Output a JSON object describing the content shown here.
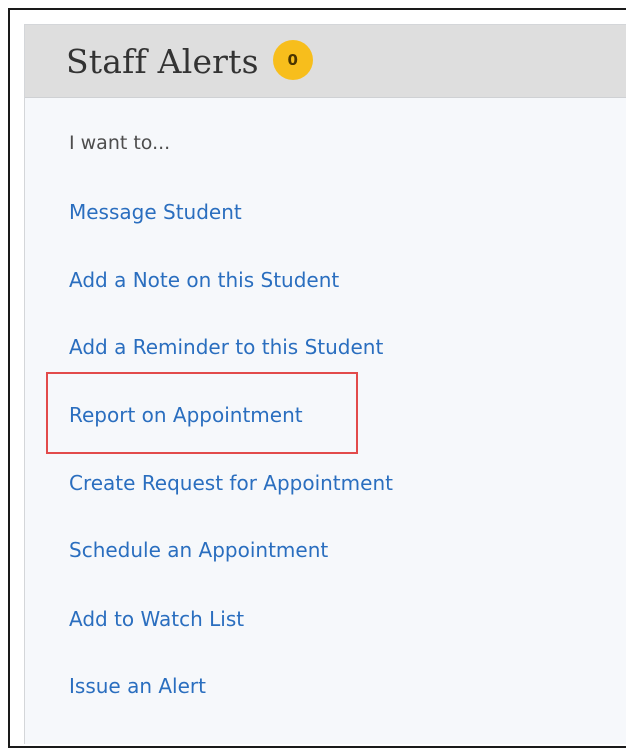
{
  "panel": {
    "title": "Staff Alerts",
    "badge_count": "0",
    "intro": "I want to..."
  },
  "actions": [
    {
      "label": "Message Student"
    },
    {
      "label": "Add a Note on this Student"
    },
    {
      "label": "Add a Reminder to this Student"
    },
    {
      "label": "Report on Appointment"
    },
    {
      "label": "Create Request for Appointment"
    },
    {
      "label": "Schedule an Appointment"
    },
    {
      "label": "Add to Watch List"
    },
    {
      "label": "Issue an Alert"
    }
  ],
  "colors": {
    "link": "#2a6ebf",
    "badge": "#f7be1c",
    "highlight": "#e24b4b",
    "header": "#dedede",
    "panel": "#f6f8fb"
  }
}
